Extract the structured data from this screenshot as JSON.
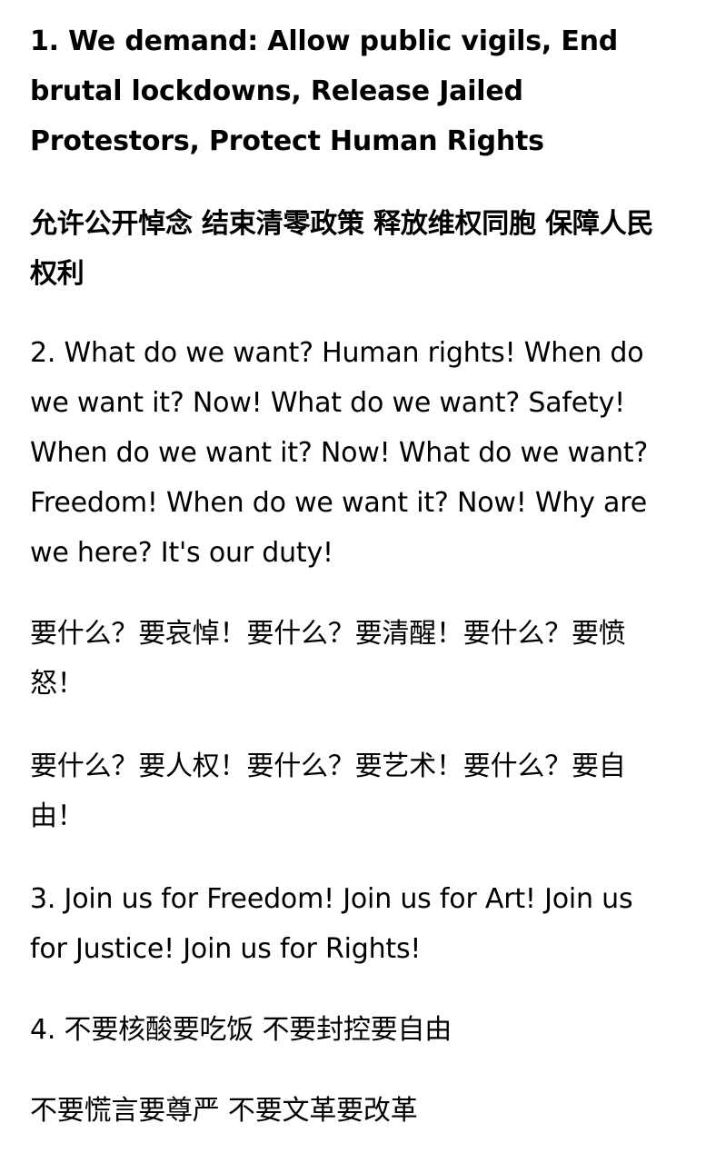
{
  "document": {
    "paragraphs": [
      {
        "id": "demand-en",
        "text": "1. We demand: Allow public vigils, End brutal lockdowns, Release Jailed Protestors, Protect Human Rights"
      },
      {
        "id": "demand-zh",
        "text": "允许公开悼念 结束清零政策 释放维权同胞 保障人民权利"
      },
      {
        "id": "chant-en",
        "text": "2. What do we want? Human rights! When do we want it? Now! What do we want? Safety! When do we want it? Now! What do we want? Freedom! When do we want it? Now! Why are we here? It's our duty!"
      },
      {
        "id": "chant-zh-1",
        "text": "要什么？要哀悼！要什么？要清醒！要什么？要愤怒！"
      },
      {
        "id": "chant-zh-2",
        "text": "要什么？要人权！要什么？要艺术！要什么？要自由！"
      },
      {
        "id": "join-en",
        "text": "3. Join us for Freedom! Join us for Art! Join us for Justice! Join us for Rights!"
      },
      {
        "id": "slogan-zh-1",
        "text": "4. 不要核酸要吃饭 不要封控要自由"
      },
      {
        "id": "slogan-zh-2",
        "text": "不要慌言要尊严 不要文革要改革"
      }
    ]
  }
}
